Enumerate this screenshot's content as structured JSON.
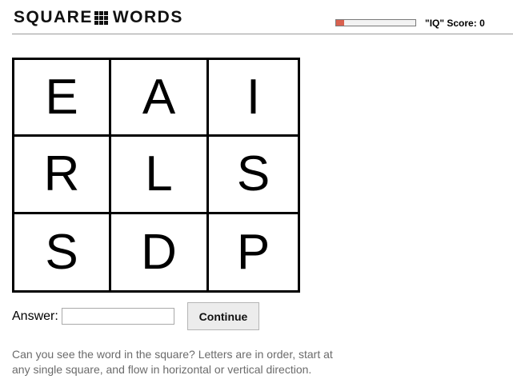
{
  "header": {
    "logo_left": "SQUARE",
    "logo_right": "WORDS",
    "iq_score_label": "\"IQ\" Score: 0",
    "iq_progress_fraction": 0.1
  },
  "board": {
    "rows": [
      [
        "E",
        "A",
        "I"
      ],
      [
        "R",
        "L",
        "S"
      ],
      [
        "S",
        "D",
        "P"
      ]
    ]
  },
  "answer": {
    "label": "Answer:",
    "value": "",
    "placeholder": ""
  },
  "continue_button": {
    "label": "Continue"
  },
  "instructions": {
    "text": "Can you see the word in the square? Letters are in order, start at any single square, and flow in horizontal or vertical direction."
  },
  "colors": {
    "iq_fill": "#d9614f",
    "instructions_text": "#6b6b6b",
    "button_bg": "#ececec"
  }
}
